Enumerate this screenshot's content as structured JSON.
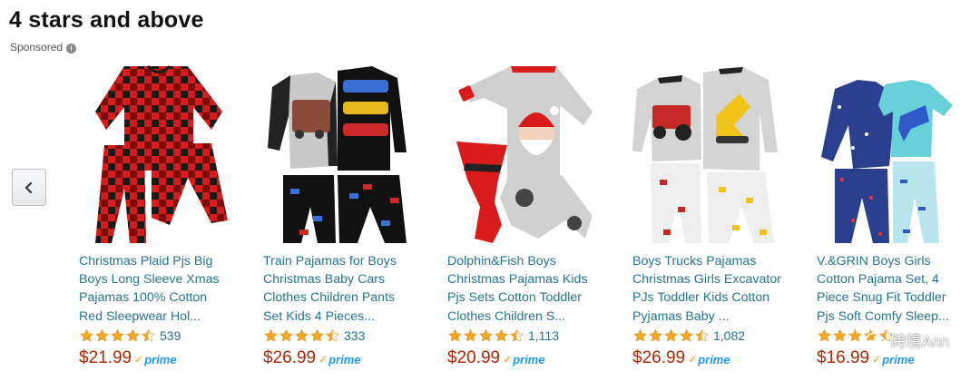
{
  "section": {
    "title": "4 stars and above",
    "sponsored_label": "Sponsored",
    "info_icon": "i"
  },
  "carousel": {
    "prev_icon": "chevron-left-icon"
  },
  "products": [
    {
      "title_lines": [
        "Christmas Plaid Pjs Big",
        "Boys Long Sleeve Xmas",
        "Pajamas 100% Cotton",
        "Red Sleepwear Hol..."
      ],
      "rating": 4.5,
      "reviews": "539",
      "price": "$21.99",
      "image": "red-black-plaid-pajamas"
    },
    {
      "title_lines": [
        "Train Pajamas for Boys",
        "Christmas Baby Cars",
        "Clothes Children Pants",
        "Set Kids 4 Pieces..."
      ],
      "rating": 4.5,
      "reviews": "333",
      "price": "$26.99",
      "image": "train-and-cars-pajamas"
    },
    {
      "title_lines": [
        "Dolphin&Fish Boys",
        "Christmas Pajamas Kids",
        "Pjs Sets Cotton Toddler",
        "Clothes Children S..."
      ],
      "rating": 4.5,
      "reviews": "1,113",
      "price": "$20.99",
      "image": "santa-pajamas"
    },
    {
      "title_lines": [
        "Boys Trucks Pajamas",
        "Christmas Girls Excavator",
        "PJs Toddler Kids Cotton",
        "Pyjamas Baby ..."
      ],
      "rating": 4.5,
      "reviews": "1,082",
      "price": "$26.99",
      "image": "tractor-excavator-pajamas"
    },
    {
      "title_lines": [
        "V.&GRIN Boys Girls",
        "Cotton Pajama Set, 4",
        "Piece Snug Fit Toddler",
        "Pjs Soft Comfy Sleep..."
      ],
      "rating": 4.5,
      "reviews": "",
      "price": "$16.99",
      "image": "dinosaur-pajamas"
    }
  ],
  "prime_label": "prime",
  "watermark": {
    "text": "跨境Ann"
  },
  "colors": {
    "link": "#26768f",
    "price": "#b12704",
    "star": "#f5a623",
    "prime": "#1a98ff"
  }
}
